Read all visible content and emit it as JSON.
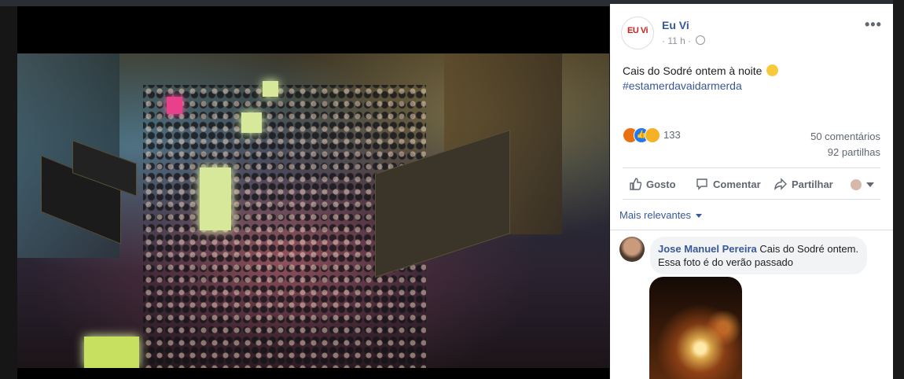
{
  "post": {
    "page_name": "Eu Vi",
    "logo_text": "EU Vi",
    "time": "11 h",
    "dot": "·",
    "text": "Cais do Sodré ontem à noite",
    "hashtag": "#estamerdavaidarmerda",
    "reaction_count": "133",
    "comments_count": "50 comentários",
    "shares_count": "92 partilhas",
    "more_icon": "more-horizontal-icon"
  },
  "actions": {
    "like": "Gosto",
    "comment": "Comentar",
    "share": "Partilhar"
  },
  "comments_filter": "Mais relevantes",
  "comment": {
    "author": "Jose Manuel Pereira",
    "text": "Cais do Sodré ontem. Essa foto é do verão passado"
  },
  "colors": {
    "link": "#385898",
    "secondary": "#606770",
    "like_blue": "#2078f4",
    "angry_orange": "#e9710f",
    "sad_yellow": "#f7b125"
  }
}
